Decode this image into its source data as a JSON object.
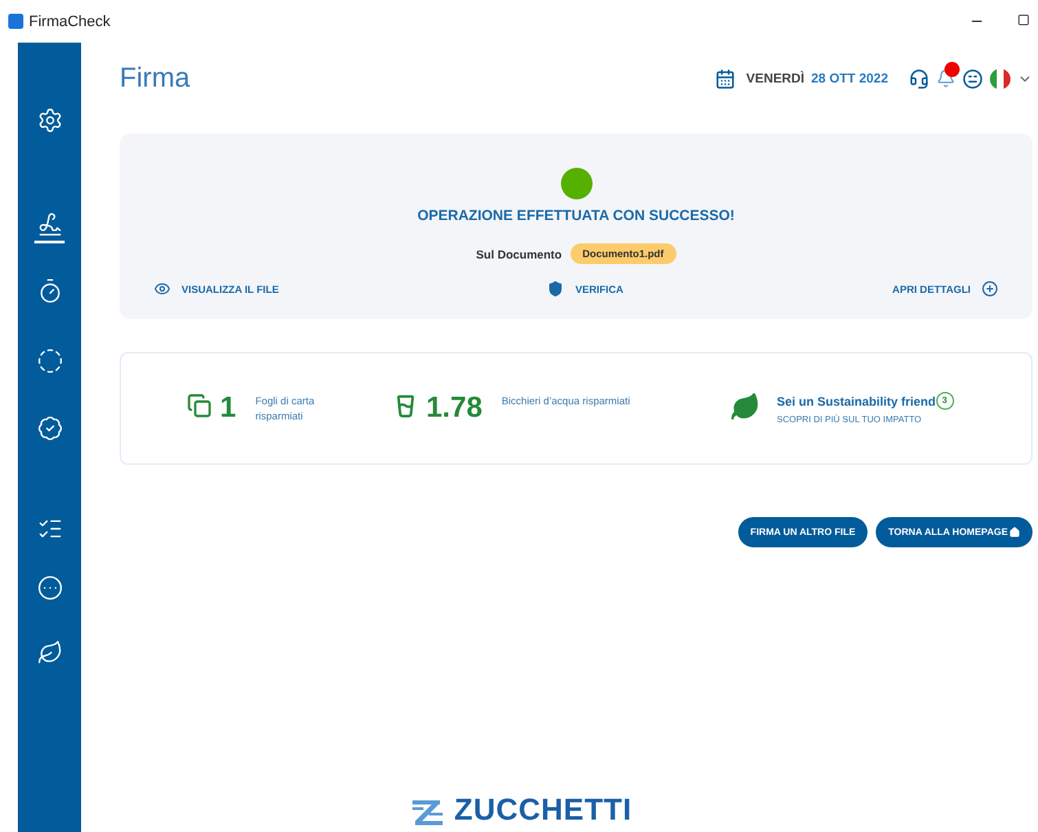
{
  "window": {
    "title": "FirmaCheck"
  },
  "sidebar": {
    "items": [
      {
        "kind": "settings",
        "selected": false
      },
      {
        "kind": "signature",
        "selected": true
      },
      {
        "kind": "timer",
        "selected": false
      },
      {
        "kind": "dotted",
        "selected": false
      },
      {
        "kind": "badge",
        "selected": false
      },
      {
        "kind": "list",
        "selected": false
      },
      {
        "kind": "more",
        "selected": false
      },
      {
        "kind": "leaf",
        "selected": false
      }
    ]
  },
  "header": {
    "title": "Firma",
    "day": "VENERDÌ",
    "date": "28 OTT 2022",
    "notification_dot": true
  },
  "result": {
    "message": "OPERAZIONE EFFETTUATA CON SUCCESSO!",
    "document_label": "Sul Documento",
    "document": "Documento1.pdf",
    "actions": [
      {
        "kind": "view",
        "label": "VISUALIZZA IL FILE"
      },
      {
        "kind": "verify",
        "label": "VERIFICA"
      },
      {
        "kind": "details",
        "label": "APRI DETTAGLI"
      }
    ]
  },
  "stats": [
    {
      "kind": "paper",
      "value": "1",
      "label": "Fogli di carta risparmiati"
    },
    {
      "kind": "water",
      "value": "1.78",
      "label": "Bicchieri d’acqua risparmiati"
    },
    {
      "kind": "friend",
      "title": "Sei un Sustainability friend",
      "badge": "3",
      "link": "SCOPRI DI PIÙ SUL TUO IMPATTO"
    }
  ],
  "buttons": [
    {
      "kind": "again",
      "label": "FIRMA UN ALTRO FILE"
    },
    {
      "kind": "home",
      "label": "TORNA ALLA HOMEPAGE"
    }
  ],
  "footer": {
    "logo": "ZUCCHETTI"
  }
}
